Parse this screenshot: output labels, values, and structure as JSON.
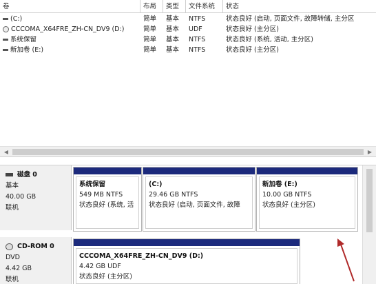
{
  "columns": [
    "卷",
    "布局",
    "类型",
    "文件系统",
    "状态"
  ],
  "volumes": [
    {
      "name": "(C:)",
      "layout": "简单",
      "type": "基本",
      "fs": "NTFS",
      "status": "状态良好 (启动, 页面文件, 故障转储, 主分区",
      "icon": "drive-bar-icon"
    },
    {
      "name": "CCCOMA_X64FRE_ZH-CN_DV9 (D:)",
      "layout": "简单",
      "type": "基本",
      "fs": "UDF",
      "status": "状态良好 (主分区)",
      "icon": "cd-drive-icon"
    },
    {
      "name": "系统保留",
      "layout": "简单",
      "type": "基本",
      "fs": "NTFS",
      "status": "状态良好 (系统, 活动, 主分区)",
      "icon": "drive-bar-icon"
    },
    {
      "name": "新加卷 (E:)",
      "layout": "简单",
      "type": "基本",
      "fs": "NTFS",
      "status": "状态良好 (主分区)",
      "icon": "drive-bar-icon"
    }
  ],
  "scroll_arrows": {
    "left": "◀",
    "right": "▶"
  },
  "disks": [
    {
      "title": "磁盘 0",
      "kind": "基本",
      "size": "40.00 GB",
      "state": "联机",
      "icon": "hard-disk-icon",
      "partitions": [
        {
          "name": "系统保留",
          "size": "549 MB NTFS",
          "status": "状态良好 (系统, 活"
        },
        {
          "name": "(C:)",
          "size": "29.46 GB NTFS",
          "status": "状态良好 (启动, 页面文件, 故障"
        },
        {
          "name": "新加卷  (E:)",
          "size": "10.00 GB NTFS",
          "status": "状态良好 (主分区)"
        }
      ]
    },
    {
      "title": "CD-ROM 0",
      "kind": "DVD",
      "size": "4.42 GB",
      "state": "联机",
      "icon": "cd-rom-icon",
      "partitions": [
        {
          "name": "CCCOMA_X64FRE_ZH-CN_DV9  (D:)",
          "size": "4.42 GB UDF",
          "status": "状态良好 (主分区)"
        }
      ]
    }
  ],
  "colors": {
    "partition_band": "#1c2a7c",
    "annotation_arrow": "#b02a2a"
  }
}
